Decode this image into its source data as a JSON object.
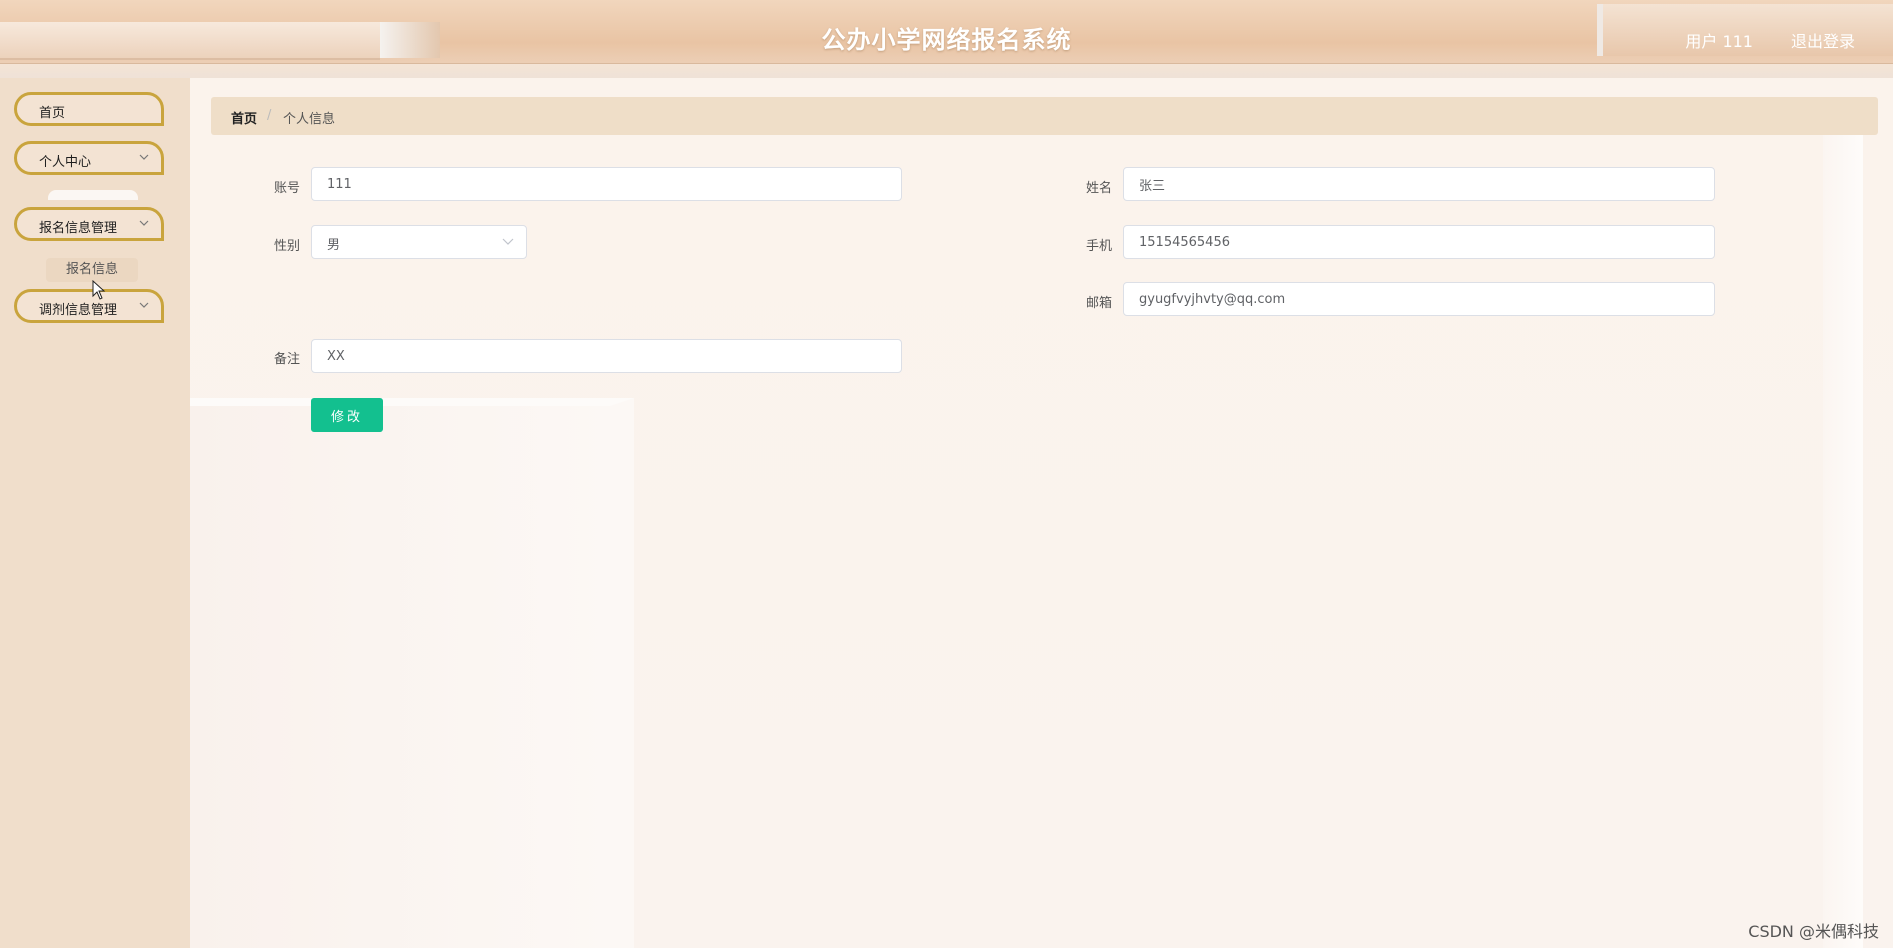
{
  "header": {
    "title": "公办小学网络报名系统",
    "user_label": "用户 111",
    "logout_label": "退出登录"
  },
  "sidebar": {
    "items": [
      {
        "label": "首页",
        "has_chevron": false
      },
      {
        "label": "个人中心",
        "has_chevron": true
      },
      {
        "label": "报名信息管理",
        "has_chevron": true
      },
      {
        "label": "调剂信息管理",
        "has_chevron": true
      }
    ],
    "submenu_item": "报名信息",
    "chevron_icon": "chevron-down-icon"
  },
  "breadcrumb": {
    "home": "首页",
    "separator": "/",
    "current": "个人信息"
  },
  "form": {
    "account": {
      "label": "账号",
      "value": "111"
    },
    "name": {
      "label": "姓名",
      "value": "张三"
    },
    "gender": {
      "label": "性别",
      "value": "男"
    },
    "phone": {
      "label": "手机",
      "value": "15154565456"
    },
    "email": {
      "label": "邮箱",
      "value": "gyugfvyjhvty@qq.com"
    },
    "remark": {
      "label": "备注",
      "value": "XX"
    },
    "submit_label": "修改"
  },
  "watermark": "CSDN @米偶科技",
  "colors": {
    "accent": "#13c08f",
    "menu_border": "#c9a43d",
    "sidebar_bg": "#f0decb",
    "breadcrumb_bg": "#efdec8"
  }
}
